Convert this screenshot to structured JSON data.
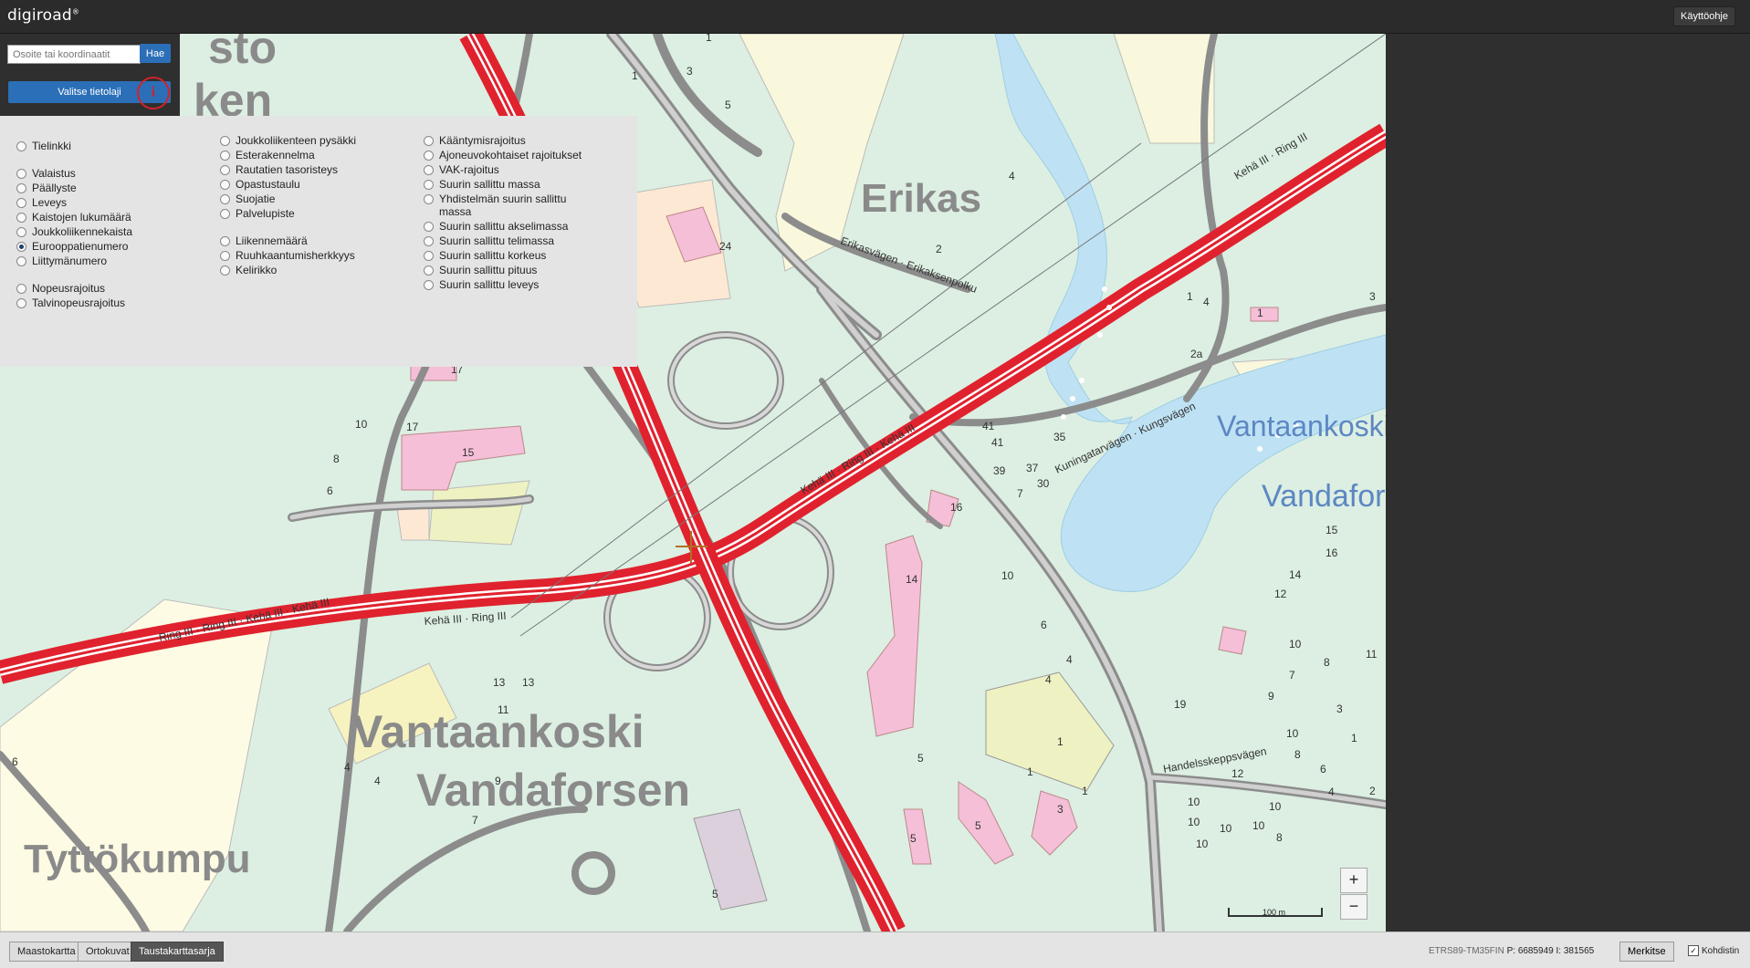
{
  "app": {
    "logo": "digiroad",
    "logo_mark": "®",
    "help_label": "Käyttöohje"
  },
  "search": {
    "placeholder": "Osoite tai koordinaatit",
    "button_label": "Hae"
  },
  "layer_selector": {
    "button_label": "Valitse tietolaji",
    "info_marker": "i"
  },
  "layers": {
    "col1": [
      {
        "label": "Tielinkki",
        "checked": false
      },
      {
        "label": "Valaistus",
        "checked": false
      },
      {
        "label": "Päällyste",
        "checked": false
      },
      {
        "label": "Leveys",
        "checked": false
      },
      {
        "label": "Kaistojen lukumäärä",
        "checked": false
      },
      {
        "label": "Joukkoliikennekaista",
        "checked": false
      },
      {
        "label": "Eurooppatienumero",
        "checked": true
      },
      {
        "label": "Liittymänumero",
        "checked": false
      },
      {
        "label": "Nopeusrajoitus",
        "checked": false
      },
      {
        "label": "Talvinopeusrajoitus",
        "checked": false
      }
    ],
    "col2": [
      {
        "label": "Joukkoliikenteen pysäkki",
        "checked": false
      },
      {
        "label": "Esterakennelma",
        "checked": false
      },
      {
        "label": "Rautatien tasoristeys",
        "checked": false
      },
      {
        "label": "Opastustaulu",
        "checked": false
      },
      {
        "label": "Suojatie",
        "checked": false
      },
      {
        "label": "Palvelupiste",
        "checked": false
      },
      {
        "label": "Liikennemäärä",
        "checked": false
      },
      {
        "label": "Ruuhkaantumisherkkyys",
        "checked": false
      },
      {
        "label": "Kelirikko",
        "checked": false
      }
    ],
    "col3": [
      {
        "label": "Kääntymisrajoitus",
        "checked": false
      },
      {
        "label": "Ajoneuvokohtaiset rajoitukset",
        "checked": false
      },
      {
        "label": "VAK-rajoitus",
        "checked": false
      },
      {
        "label": "Suurin sallittu massa",
        "checked": false
      },
      {
        "label": "Yhdistelmän suurin sallittu massa",
        "checked": false
      },
      {
        "label": "Suurin sallittu akselimassa",
        "checked": false
      },
      {
        "label": "Suurin sallittu telimassa",
        "checked": false
      },
      {
        "label": "Suurin sallittu korkeus",
        "checked": false
      },
      {
        "label": "Suurin sallittu pituus",
        "checked": false
      },
      {
        "label": "Suurin sallittu leveys",
        "checked": false
      }
    ]
  },
  "map": {
    "labels": {
      "erikas": "Erikas",
      "vantaankoski": "Vantaankoski",
      "vandaforsen": "Vandaforsen",
      "tyyppi": "Tyttökumpu",
      "vantaankoski_water": "Vantaankoski",
      "vandafors_water": "Vandafors",
      "top_fragment": "sto",
      "top_fragment2": "ken"
    },
    "scale_label": "100 m",
    "zoom_in": "+",
    "zoom_out": "−"
  },
  "bottombar": {
    "basemaps": [
      {
        "label": "Maastokartta",
        "active": false
      },
      {
        "label": "Ortokuvat",
        "active": false
      },
      {
        "label": "Taustakarttasarja",
        "active": true
      }
    ],
    "projection": "ETRS89-TM35FIN",
    "coord_p_label": "P:",
    "coord_p": "6685949",
    "coord_i_label": "I:",
    "coord_i": "381565",
    "mark_label": "Merkitse",
    "crosshair_label": "Kohdistin",
    "crosshair_checked": true
  }
}
